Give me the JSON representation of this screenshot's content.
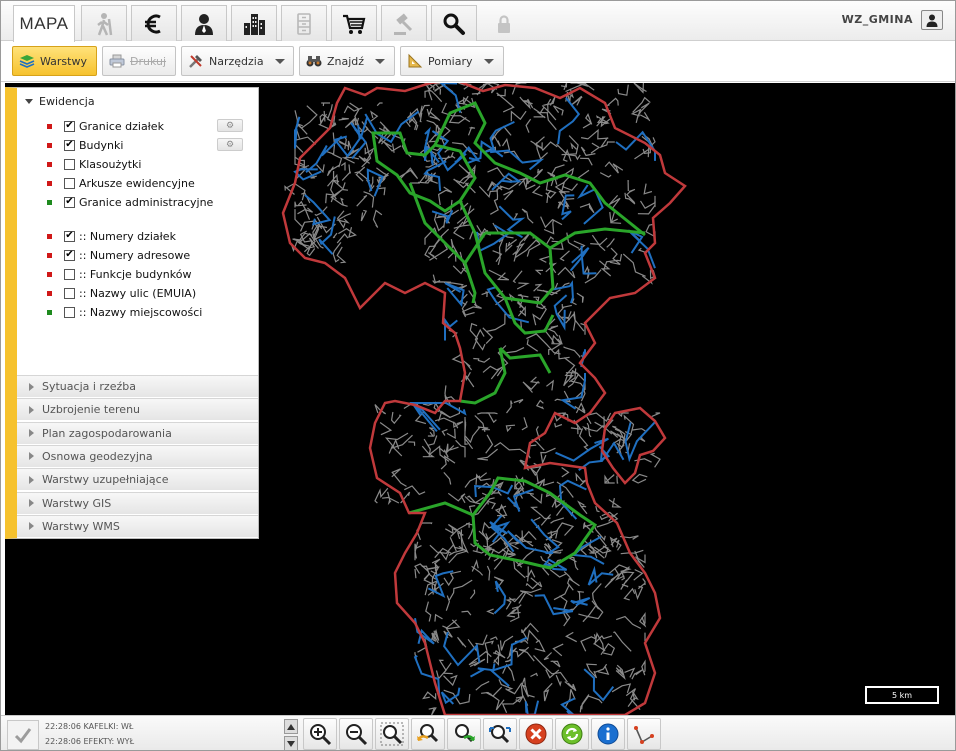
{
  "topbar": {
    "tabs": [
      {
        "id": "mapa",
        "label": "MAPA",
        "icon": "",
        "active": true
      },
      {
        "id": "hiker",
        "label": "",
        "icon": "hiker-icon",
        "active": false
      },
      {
        "id": "euro",
        "label": "",
        "icon": "euro-icon",
        "active": false
      },
      {
        "id": "person",
        "label": "",
        "icon": "person-icon",
        "active": false
      },
      {
        "id": "buildings",
        "label": "",
        "icon": "buildings-icon",
        "active": false
      },
      {
        "id": "cabinet",
        "label": "",
        "icon": "filing-cabinet-icon",
        "active": false
      },
      {
        "id": "cart",
        "label": "",
        "icon": "cart-icon",
        "active": false
      },
      {
        "id": "gavel",
        "label": "",
        "icon": "gavel-icon",
        "active": false
      },
      {
        "id": "search",
        "label": "",
        "icon": "search-icon",
        "active": false
      },
      {
        "id": "lock",
        "label": "",
        "icon": "lock-icon",
        "active": false
      }
    ],
    "user_name": "WZ_GMINA"
  },
  "toolbar": {
    "warstwy": "Warstwy",
    "drukuj": "Drukuj",
    "narzedzia": "Narzędzia",
    "znajdz": "Znajdź",
    "pomiary": "Pomiary"
  },
  "panel": {
    "header": "Ewidencja",
    "layers": [
      {
        "label": "Granice działek",
        "checked": true,
        "color": "#d01818",
        "settings": true
      },
      {
        "label": "Budynki",
        "checked": true,
        "color": "#d01818",
        "settings": true
      },
      {
        "label": "Klasoużytki",
        "checked": false,
        "color": "#d01818",
        "settings": false
      },
      {
        "label": "Arkusze ewidencyjne",
        "checked": false,
        "color": "#d01818",
        "settings": false
      },
      {
        "label": "Granice administracyjne",
        "checked": true,
        "color": "#1e8a1e",
        "settings": false
      },
      {
        "label": ":: Numery działek",
        "checked": true,
        "color": "#d01818",
        "settings": false
      },
      {
        "label": ":: Numery adresowe",
        "checked": true,
        "color": "#d01818",
        "settings": false
      },
      {
        "label": ":: Funkcje budynków",
        "checked": false,
        "color": "#d01818",
        "settings": false
      },
      {
        "label": ":: Nazwy ulic (EMUIA)",
        "checked": false,
        "color": "#d01818",
        "settings": false
      },
      {
        "label": ":: Nazwy miejscowości",
        "checked": false,
        "color": "#1e8a1e",
        "settings": false
      }
    ],
    "sections": [
      "Sytuacja i rzeźba",
      "Uzbrojenie terenu",
      "Plan zagospodarowania",
      "Osnowa geodezyjna",
      "Warstwy uzupełniające",
      "Warstwy GIS",
      "Warstwy WMS"
    ]
  },
  "map": {
    "scale_label": "5 km",
    "colors": {
      "background": "#000000",
      "boundary": "#c0393b",
      "roads_blue": "#1f6fc0",
      "roads_gray": "#8a8a8a",
      "admin_green": "#2aa52a"
    }
  },
  "status": {
    "log": [
      {
        "time": "22:28:06",
        "text": "KAFELKI: WŁ"
      },
      {
        "time": "22:28:06",
        "text": "EFEKTY: WYŁ"
      }
    ]
  },
  "bottom_tools": [
    "zoom-in-icon",
    "zoom-out-icon",
    "zoom-extent-icon",
    "zoom-previous-icon",
    "zoom-next-icon",
    "zoom-window-icon",
    "clear-icon",
    "refresh-icon",
    "info-icon",
    "measure-icon"
  ]
}
